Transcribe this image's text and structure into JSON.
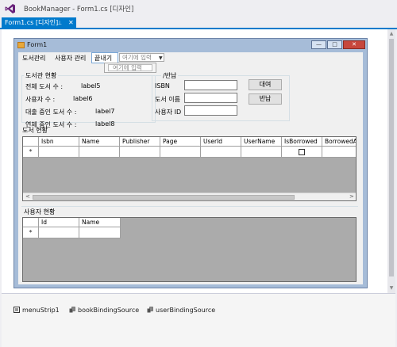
{
  "window": {
    "title": "BookManager - Form1.cs [디자인]"
  },
  "tab": {
    "label": "Form1.cs [디자인]",
    "pin": "⊥",
    "close": "✕"
  },
  "form": {
    "title": "Form1",
    "caption_buttons": {
      "min": "—",
      "max": "□",
      "close": "✕"
    },
    "menu": {
      "items": [
        "도서관리",
        "사용자 관리",
        "끝내기"
      ],
      "type_here": "여기에 입력",
      "submenu_type_here": "여기에 입력"
    },
    "library_status": {
      "title": "도서관 현황",
      "rows": [
        {
          "label": "전체 도서 수 :",
          "value": "label5"
        },
        {
          "label": "사용자 수 :",
          "value": "label6"
        },
        {
          "label": "대출 중인 도서 수 :",
          "value": "label7"
        },
        {
          "label": "연체 중인 도서 수 :",
          "value": "label8"
        }
      ]
    },
    "loan": {
      "title": "/반납",
      "fields": [
        "ISBN",
        "도서 이름",
        "사용자 ID"
      ],
      "buttons": {
        "borrow": "대여",
        "return": "반납"
      }
    },
    "book_status": {
      "title": "도서 현황",
      "columns": [
        "Isbn",
        "Name",
        "Publisher",
        "Page",
        "UserId",
        "UserName",
        "IsBorrowed",
        "BorrowedAt"
      ],
      "new_row_marker": "*",
      "scroll_left": "<",
      "scroll_right": ">"
    },
    "user_status": {
      "title": "사용자 현황",
      "columns": [
        "Id",
        "Name"
      ],
      "new_row_marker": "*"
    }
  },
  "tray": {
    "components": [
      "menuStrip1",
      "bookBindingSource",
      "userBindingSource"
    ]
  },
  "colors": {
    "accent": "#007acc",
    "form_border": "#a6bcd8",
    "grid_background": "#ababab"
  }
}
